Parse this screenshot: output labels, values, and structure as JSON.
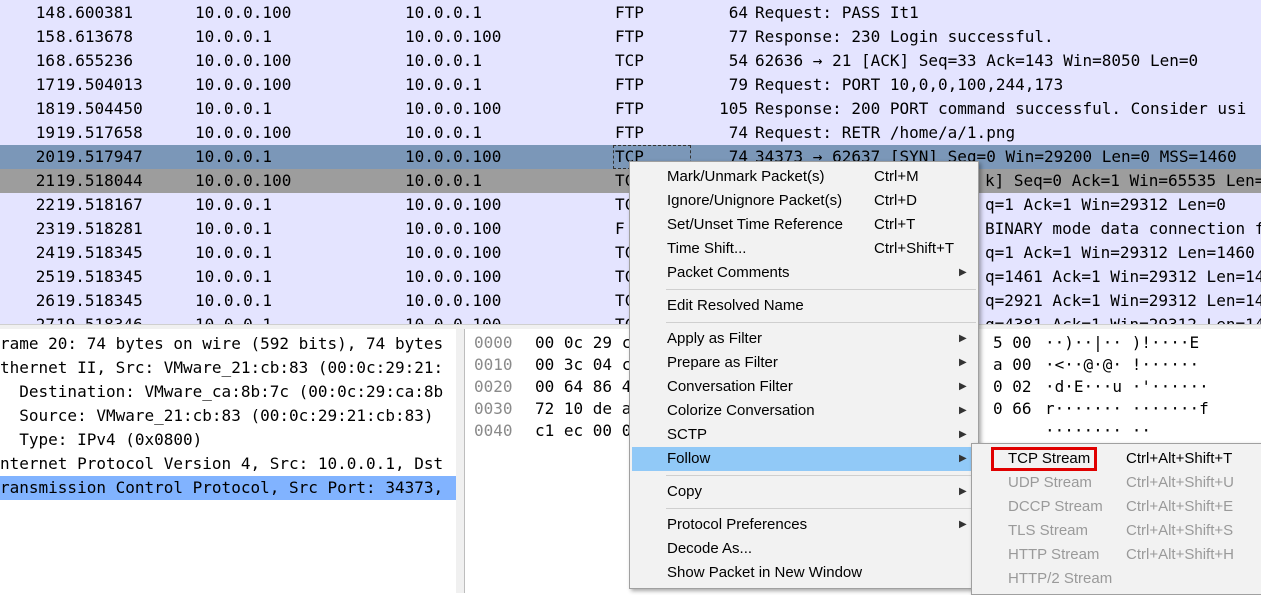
{
  "packets": [
    {
      "no": "14",
      "time": "8.600381",
      "src": "10.0.0.100",
      "dst": "10.0.0.1",
      "proto": "FTP",
      "len": "64",
      "info": "Request: PASS It1"
    },
    {
      "no": "15",
      "time": "8.613678",
      "src": "10.0.0.1",
      "dst": "10.0.0.100",
      "proto": "FTP",
      "len": "77",
      "info": "Response: 230 Login successful."
    },
    {
      "no": "16",
      "time": "8.655236",
      "src": "10.0.0.100",
      "dst": "10.0.0.1",
      "proto": "TCP",
      "len": "54",
      "info": "62636 → 21 [ACK] Seq=33 Ack=143 Win=8050 Len=0"
    },
    {
      "no": "17",
      "time": "19.504013",
      "src": "10.0.0.100",
      "dst": "10.0.0.1",
      "proto": "FTP",
      "len": "79",
      "info": "Request: PORT 10,0,0,100,244,173"
    },
    {
      "no": "18",
      "time": "19.504450",
      "src": "10.0.0.1",
      "dst": "10.0.0.100",
      "proto": "FTP",
      "len": "105",
      "info": "Response: 200 PORT command successful. Consider usi"
    },
    {
      "no": "19",
      "time": "19.517658",
      "src": "10.0.0.100",
      "dst": "10.0.0.1",
      "proto": "FTP",
      "len": "74",
      "info": "Request: RETR /home/a/1.png"
    },
    {
      "no": "20",
      "time": "19.517947",
      "src": "10.0.0.1",
      "dst": "10.0.0.100",
      "proto": "TCP",
      "len": "74",
      "info": "34373 → 62637 [SYN] Seq=0 Win=29200 Len=0 MSS=1460"
    },
    {
      "no": "21",
      "time": "19.518044",
      "src": "10.0.0.100",
      "dst": "10.0.0.1",
      "proto": "TC",
      "len": "",
      "info": "k] Seq=0 Ack=1 Win=65535 Len="
    },
    {
      "no": "22",
      "time": "19.518167",
      "src": "10.0.0.1",
      "dst": "10.0.0.100",
      "proto": "TC",
      "len": "",
      "info": "q=1 Ack=1 Win=29312 Len=0"
    },
    {
      "no": "23",
      "time": "19.518281",
      "src": "10.0.0.1",
      "dst": "10.0.0.100",
      "proto": "F",
      "len": "",
      "info": "BINARY mode data connection f"
    },
    {
      "no": "24",
      "time": "19.518345",
      "src": "10.0.0.1",
      "dst": "10.0.0.100",
      "proto": "TC",
      "len": "",
      "info": "q=1 Ack=1 Win=29312 Len=1460"
    },
    {
      "no": "25",
      "time": "19.518345",
      "src": "10.0.0.1",
      "dst": "10.0.0.100",
      "proto": "TC",
      "len": "",
      "info": "q=1461 Ack=1 Win=29312 Len=14"
    },
    {
      "no": "26",
      "time": "19.518345",
      "src": "10.0.0.1",
      "dst": "10.0.0.100",
      "proto": "TC",
      "len": "",
      "info": "q=2921 Ack=1 Win=29312 Len=14"
    },
    {
      "no": "27",
      "time": "19.518346",
      "src": "10.0.0.1",
      "dst": "10.0.0.100",
      "proto": "TC",
      "len": "",
      "info": "q=4381 Ack=1 Win=29312 Len=14"
    }
  ],
  "details": [
    "rame 20: 74 bytes on wire (592 bits), 74 bytes",
    "thernet II, Src: VMware_21:cb:83 (00:0c:29:21:",
    "  Destination: VMware_ca:8b:7c (00:0c:29:ca:8b",
    "  Source: VMware_21:cb:83 (00:0c:29:21:cb:83)",
    "  Type: IPv4 (0x0800)",
    "nternet Protocol Version 4, Src: 10.0.0.1, Dst",
    "ransmission Control Protocol, Src Port: 34373,"
  ],
  "bytes": [
    {
      "offset": "0000",
      "hex": "00 0c 29 c",
      "hex2": "5 00",
      "ascii": "··)··|·· )!····E"
    },
    {
      "offset": "0010",
      "hex": "00 3c 04 c",
      "hex2": "a 00",
      "ascii": "·<··@·@· !······"
    },
    {
      "offset": "0020",
      "hex": "00 64 86 4",
      "hex2": "0 02",
      "ascii": "·d·E···u ·'······"
    },
    {
      "offset": "0030",
      "hex": "72 10 de a",
      "hex2": "0 66",
      "ascii": "r······· ·······f"
    },
    {
      "offset": "0040",
      "hex": "c1 ec 00 0",
      "hex2": "",
      "ascii": "········ ··"
    }
  ],
  "context_menu": {
    "group1": [
      {
        "label": "Mark/Unmark Packet(s)",
        "shortcut": "Ctrl+M",
        "submenu": false
      },
      {
        "label": "Ignore/Unignore Packet(s)",
        "shortcut": "Ctrl+D",
        "submenu": false
      },
      {
        "label": "Set/Unset Time Reference",
        "shortcut": "Ctrl+T",
        "submenu": false
      },
      {
        "label": "Time Shift...",
        "shortcut": "Ctrl+Shift+T",
        "submenu": false
      },
      {
        "label": "Packet Comments",
        "shortcut": "",
        "submenu": true
      }
    ],
    "group2": [
      {
        "label": "Edit Resolved Name",
        "shortcut": "",
        "submenu": false
      }
    ],
    "group3": [
      {
        "label": "Apply as Filter",
        "shortcut": "",
        "submenu": true
      },
      {
        "label": "Prepare as Filter",
        "shortcut": "",
        "submenu": true
      },
      {
        "label": "Conversation Filter",
        "shortcut": "",
        "submenu": true
      },
      {
        "label": "Colorize Conversation",
        "shortcut": "",
        "submenu": true
      },
      {
        "label": "SCTP",
        "shortcut": "",
        "submenu": true
      },
      {
        "label": "Follow",
        "shortcut": "",
        "submenu": true
      }
    ],
    "group4": [
      {
        "label": "Copy",
        "shortcut": "",
        "submenu": true
      }
    ],
    "group5": [
      {
        "label": "Protocol Preferences",
        "shortcut": "",
        "submenu": true
      },
      {
        "label": "Decode As...",
        "shortcut": "",
        "submenu": false
      },
      {
        "label": "Show Packet in New Window",
        "shortcut": "",
        "submenu": false
      }
    ],
    "submenu_arrow": "▶"
  },
  "follow_submenu": [
    {
      "label": "TCP Stream",
      "shortcut": "Ctrl+Alt+Shift+T",
      "enabled": true
    },
    {
      "label": "UDP Stream",
      "shortcut": "Ctrl+Alt+Shift+U",
      "enabled": false
    },
    {
      "label": "DCCP Stream",
      "shortcut": "Ctrl+Alt+Shift+E",
      "enabled": false
    },
    {
      "label": "TLS Stream",
      "shortcut": "Ctrl+Alt+Shift+S",
      "enabled": false
    },
    {
      "label": "HTTP Stream",
      "shortcut": "Ctrl+Alt+Shift+H",
      "enabled": false
    },
    {
      "label": "HTTP/2 Stream",
      "shortcut": "",
      "enabled": false
    }
  ],
  "colors": {
    "packet_bg": "#e4e4ff",
    "selected_row": "#7b97b8",
    "marked_row": "#9d9d9d",
    "details_selected": "#81b3ff",
    "menu_highlight": "#91c9f7",
    "highlight_box": "#e00000"
  }
}
